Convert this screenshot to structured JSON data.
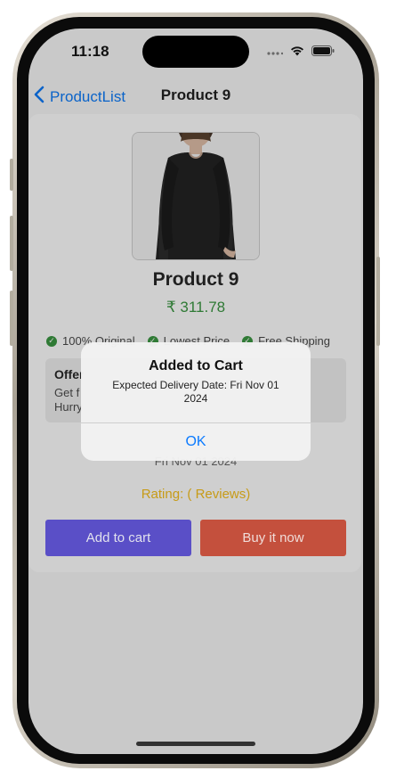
{
  "status_bar": {
    "time": "11:18"
  },
  "nav": {
    "back_label": "ProductList",
    "title": "Product 9"
  },
  "product": {
    "name": "Product 9",
    "price": "₹ 311.78",
    "badges": [
      "100% Original",
      "Lowest Price",
      "Free Shipping"
    ]
  },
  "offer": {
    "title": "Offer",
    "line1": "Get f",
    "line2": "Hurry"
  },
  "delivery": {
    "date": "Fri Nov 01 2024"
  },
  "rating": {
    "label": "Rating:  ( Reviews)"
  },
  "buttons": {
    "add_to_cart": "Add to cart",
    "buy_now": "Buy it now"
  },
  "alert": {
    "title": "Added to Cart",
    "message": "Expected Delivery Date: Fri Nov 01 2024",
    "ok_label": "OK"
  },
  "colors": {
    "accent_blue": "#0a63c9",
    "price_green": "#2f7a35",
    "rating_gold": "#c79b17",
    "add_to_cart_bg": "#5a4fc7",
    "buy_now_bg": "#c4503d"
  }
}
